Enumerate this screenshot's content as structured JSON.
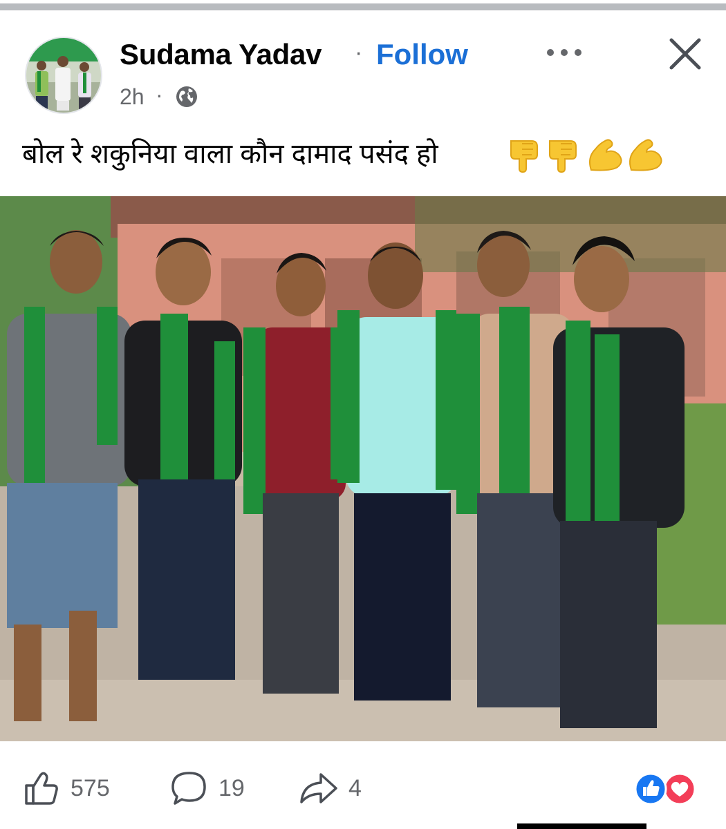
{
  "post": {
    "author": "Sudama Yadav",
    "separator": "·",
    "follow_label": "Follow",
    "time": "2h",
    "time_separator": "·",
    "audience_icon": "globe-icon",
    "text": "बोल रे शकुनिया वाला कौन दामाद पसंद हो",
    "emojis": [
      "backhand-index-pointing-down-icon",
      "backhand-index-pointing-down-icon",
      "flexed-biceps-icon",
      "flexed-biceps-icon"
    ]
  },
  "header_actions": {
    "more_icon": "more-icon",
    "close_icon": "close-icon"
  },
  "stats": {
    "likes": "575",
    "comments": "19",
    "shares": "4",
    "reactions": [
      "like-reaction-icon",
      "love-reaction-icon"
    ]
  },
  "colors": {
    "follow": "#1b6fd6",
    "text_primary": "#050505",
    "text_secondary": "#65676b",
    "like_reaction": "#1877f2",
    "love_reaction": "#f33e58",
    "scarf_green": "#1f8f3a"
  }
}
